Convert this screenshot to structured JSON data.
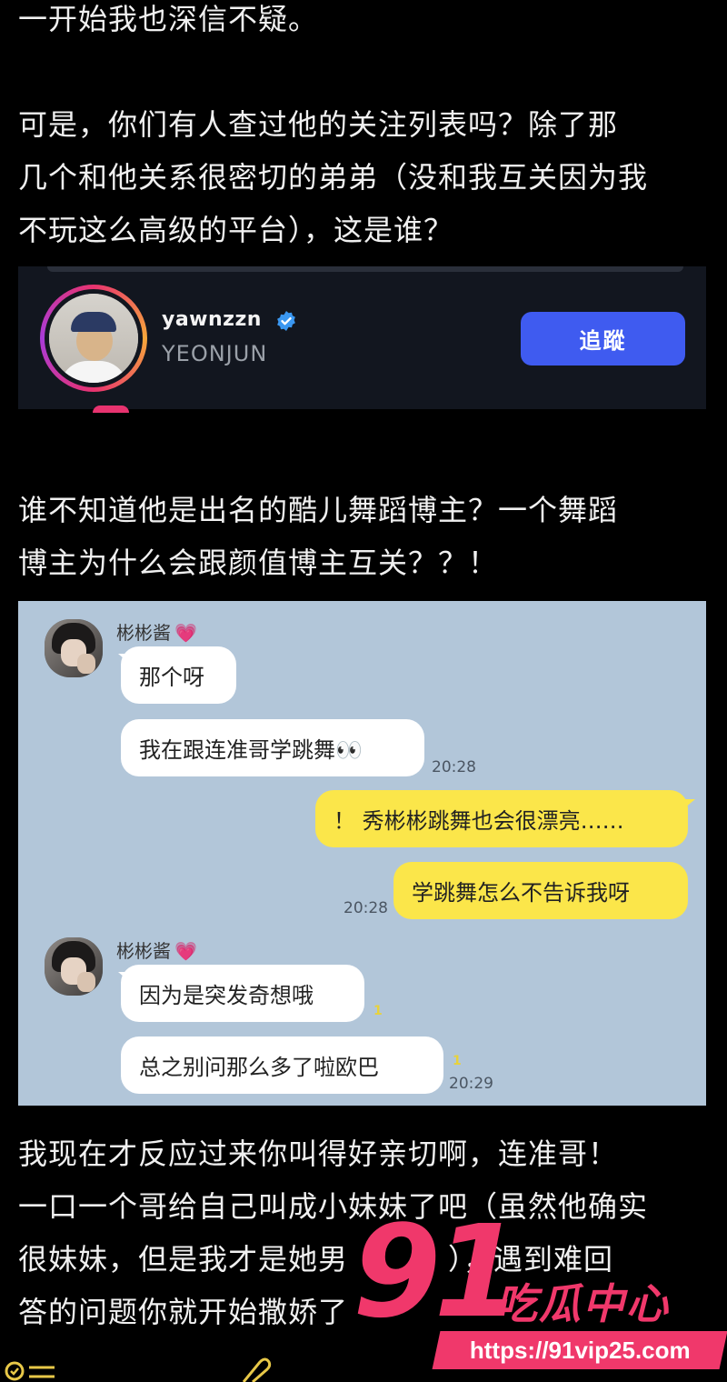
{
  "post": {
    "para1": [
      "一开始我也深信不疑。"
    ],
    "para2": [
      "可是，你们有人查过他的关注列表吗？除了那",
      "几个和他关系很密切的弟弟（没和我互关因为我",
      "不玩这么高级的平台），这是谁？"
    ],
    "para3": [
      "谁不知道他是出名的酷儿舞蹈博主？一个舞蹈",
      "博主为什么会跟颜值博主互关？？！"
    ],
    "para4": [
      "我现在才反应过来你叫得好亲切啊，连准哥！",
      "一口一个哥给自己叫成小妹妹了吧（虽然他确实",
      "很妹妹，但是我才是她男",
      "答的问题你就开始撒娇了"
    ],
    "para4_tail3": "），遇到难回"
  },
  "follow_card": {
    "username": "yawnzzn",
    "display_name": "YEONJUN",
    "follow_button": "追蹤",
    "verified_icon": "verified-badge-icon",
    "ring_colors": [
      "#e8336f",
      "#f7a83b",
      "#a93bd8"
    ],
    "button_color": "#3f5bf0"
  },
  "chat": {
    "background": "#b2c6d9",
    "sender_name": "彬彬酱",
    "heart": "💗",
    "group1": {
      "msg1": "那个呀",
      "msg2": "我在跟连准哥学跳舞👀",
      "time": "20:28"
    },
    "mine": {
      "msg1": "！ 秀彬彬跳舞也会很漂亮……",
      "msg2": "学跳舞怎么不告诉我呀",
      "time": "20:28"
    },
    "group2": {
      "msg1": "因为是突发奇想哦",
      "msg1_unread": "1",
      "msg2": "总之别问那么多了啦欧巴",
      "msg2_unread": "1",
      "time": "20:29"
    }
  },
  "watermark": {
    "number": "91",
    "brand": "吃瓜中心",
    "url": "https://91vip25.com",
    "color": "#f0386b"
  },
  "toolbar": {
    "left_icon": "list-icon",
    "clip_icon": "paperclip-icon"
  }
}
